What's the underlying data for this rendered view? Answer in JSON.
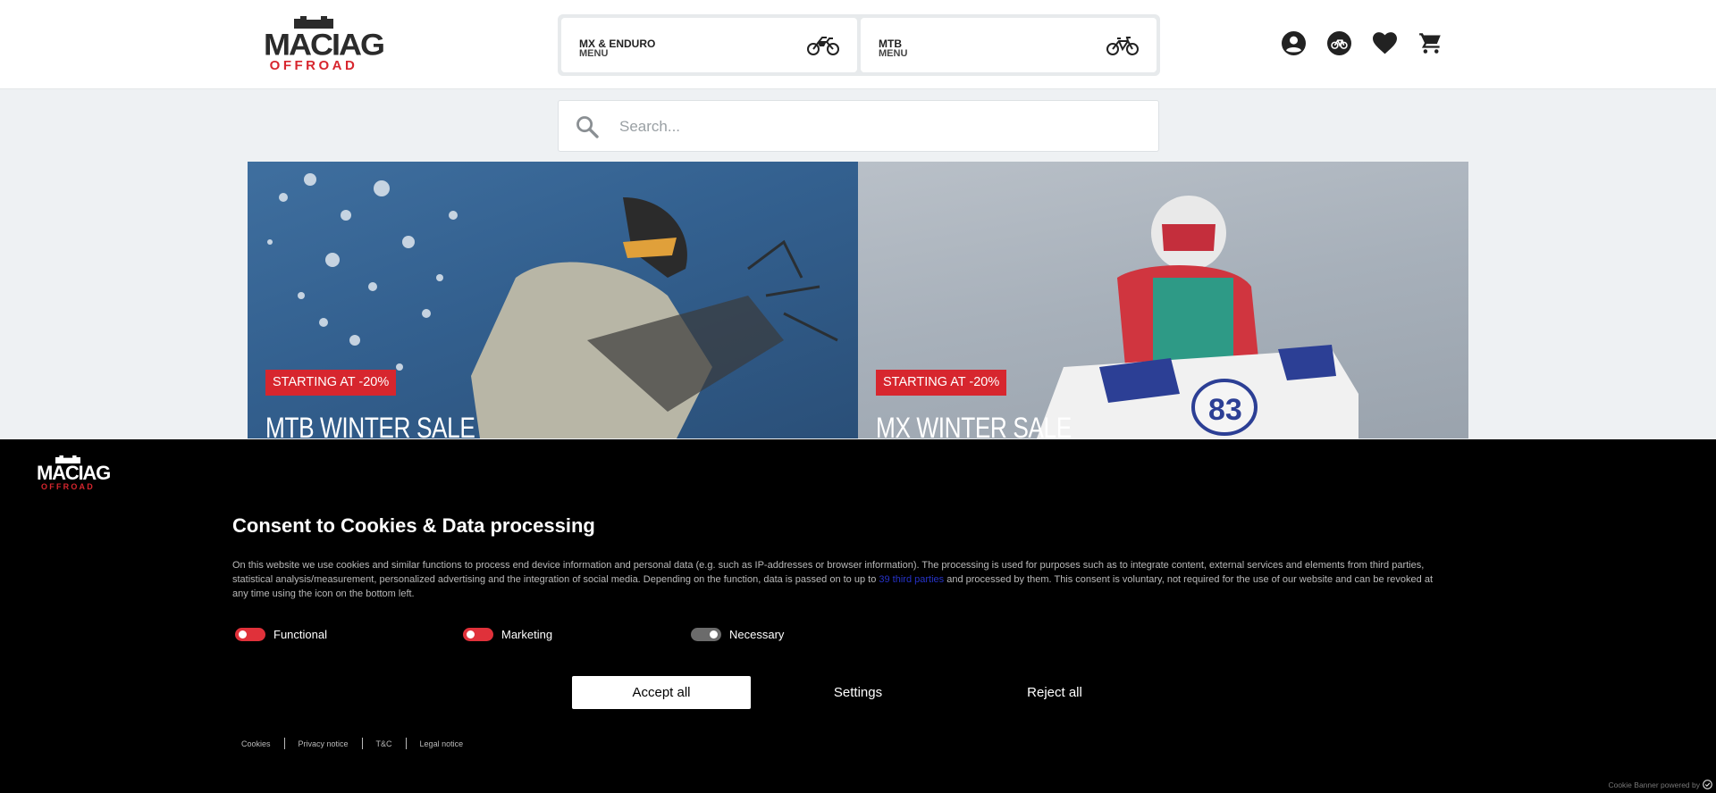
{
  "header": {
    "logo": {
      "line1": "MACIAG",
      "line2": "OFFROAD"
    },
    "menus": [
      {
        "title": "MX & ENDURO",
        "subtitle": "MENU",
        "icon": "motorcycle-icon"
      },
      {
        "title": "MTB",
        "subtitle": "MENU",
        "icon": "bicycle-icon"
      }
    ],
    "icons": [
      "account-icon",
      "bike-selector-icon",
      "wishlist-heart-icon",
      "cart-icon"
    ]
  },
  "search": {
    "placeholder": "Search..."
  },
  "banners": [
    {
      "badge": "STARTING AT -20%",
      "title": "MTB WINTER SALE"
    },
    {
      "badge": "STARTING AT -20%",
      "title": "MX WINTER SALE"
    }
  ],
  "cookie": {
    "logo": {
      "line1": "MACIAG",
      "line2": "OFFROAD"
    },
    "title": "Consent to Cookies & Data processing",
    "text_before_link": "On this website we use cookies and similar functions to process end device information and personal data (e.g. such as IP-addresses or browser information). The processing is used for purposes such as to integrate content, external services and elements from third parties, statistical analysis/measurement, personalized advertising and the integration of social media. Depending on the function, data is passed on to up to ",
    "link_text": "39 third parties",
    "text_after_link": " and processed by them. This consent is voluntary, not required for the use of our website and can be revoked at any time using the icon on the bottom left.",
    "toggles": [
      {
        "label": "Functional",
        "state": "off"
      },
      {
        "label": "Marketing",
        "state": "off"
      },
      {
        "label": "Necessary",
        "state": "on"
      }
    ],
    "buttons": {
      "accept": "Accept all",
      "settings": "Settings",
      "reject": "Reject all"
    },
    "footer_links": [
      "Cookies",
      "Privacy notice",
      "T&C",
      "Legal notice"
    ],
    "powered_by": "Cookie Banner powered by"
  },
  "colors": {
    "brand_red": "#d7262e",
    "cookie_bg": "#000000",
    "link_blue": "#2633c9"
  }
}
